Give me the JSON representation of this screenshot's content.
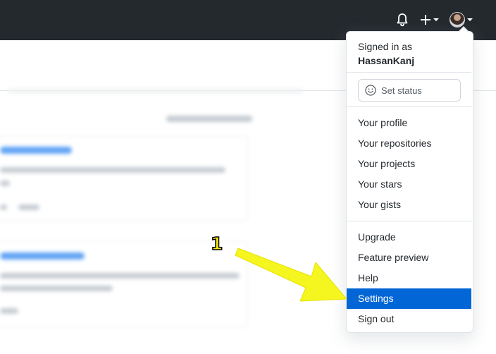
{
  "header": {
    "icons": [
      "bell-icon",
      "plus-icon",
      "avatar"
    ]
  },
  "dropdown": {
    "signed_in_label": "Signed in as",
    "username": "HassanKanj",
    "set_status_label": "Set status",
    "items_group1": [
      {
        "label": "Your profile"
      },
      {
        "label": "Your repositories"
      },
      {
        "label": "Your projects"
      },
      {
        "label": "Your stars"
      },
      {
        "label": "Your gists"
      }
    ],
    "items_group2": [
      {
        "label": "Upgrade"
      },
      {
        "label": "Feature preview"
      },
      {
        "label": "Help"
      },
      {
        "label": "Settings"
      },
      {
        "label": "Sign out"
      }
    ],
    "active_item": "Settings"
  },
  "annotation": {
    "number": "1",
    "arrow_color": "#f5f51f"
  },
  "colors": {
    "header_bg": "#24292e",
    "active_bg": "#0366d6"
  }
}
